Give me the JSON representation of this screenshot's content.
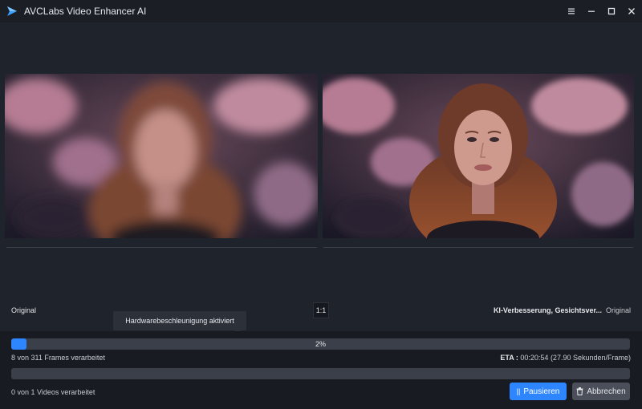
{
  "app": {
    "title": "AVCLabs Video Enhancer AI"
  },
  "preview": {
    "left_label": "Original",
    "ratio_label": "1:1",
    "model_label": "KI-Verbesserung, Gesichtsver...",
    "right_label": "Original"
  },
  "tooltip": {
    "text": "Hardwarebeschleunigung aktiviert"
  },
  "progress": {
    "percent_label": "2%",
    "fraction": 0.025,
    "frames_text": "8 von 311 Frames verarbeitet",
    "eta_label": "ETA :",
    "eta_value": "00:20:54 (27.90 Sekunden/Frame)"
  },
  "videos": {
    "text": "0 von 1 Videos verarbeitet",
    "fraction": 0
  },
  "actions": {
    "pause_icon": "||",
    "pause_label": "Pausieren",
    "cancel_label": "Abbrechen"
  },
  "colors": {
    "accent": "#2e86ff",
    "background": "#1f232b",
    "panel": "#181b21"
  }
}
